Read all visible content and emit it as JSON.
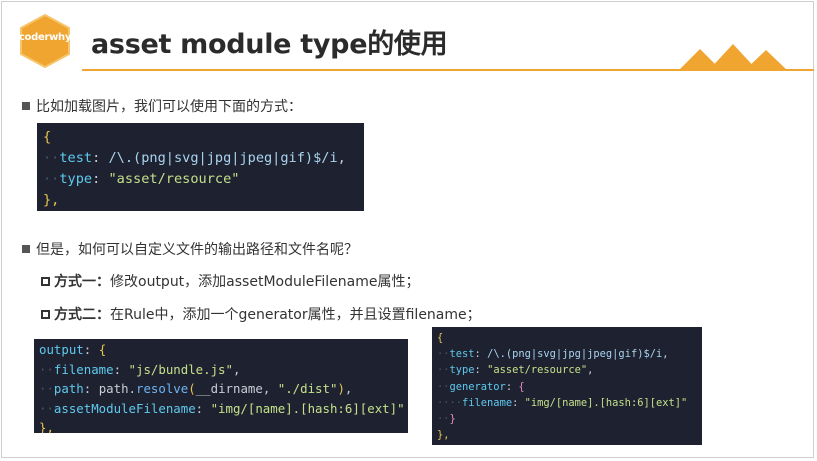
{
  "header": {
    "logo_text": "coderwhy",
    "title": "asset module type的使用"
  },
  "bullets": {
    "b1": "比如加载图片，我们可以使用下面的方式：",
    "b2": "但是，如何可以自定义文件的输出路径和文件名呢？"
  },
  "methods": {
    "m1_label": "方式一：",
    "m1_text": "修改output，添加assetModuleFilename属性；",
    "m2_label": "方式二：",
    "m2_text": "在Rule中，添加一个generator属性，并且设置filename；"
  },
  "code1": {
    "open": "{",
    "test_key": "test",
    "test_val": "/\\.(png|svg|jpg|jpeg|gif)$/i",
    "type_key": "type",
    "type_val": "\"asset/resource\"",
    "close": "},"
  },
  "code2": {
    "output_key": "output",
    "filename_key": "filename",
    "filename_val": "\"js/bundle.js\"",
    "path_key": "path",
    "path_obj": "path",
    "path_fn": "resolve",
    "path_arg1": "__dirname",
    "path_arg2": "\"./dist\"",
    "amf_key": "assetModuleFilename",
    "amf_val": "\"img/[name].[hash:6][ext]\"",
    "close": "},"
  },
  "code3": {
    "open": "{",
    "test_key": "test",
    "test_val": "/\\.(png|svg|jpg|jpeg|gif)$/i",
    "type_key": "type",
    "type_val": "\"asset/resource\"",
    "gen_key": "generator",
    "filename_key": "filename",
    "filename_val": "\"img/[name].[hash:6][ext]\"",
    "inner_close": "}",
    "close": "},"
  },
  "colors": {
    "accent": "#f0a530",
    "code_bg": "#1e2230"
  }
}
